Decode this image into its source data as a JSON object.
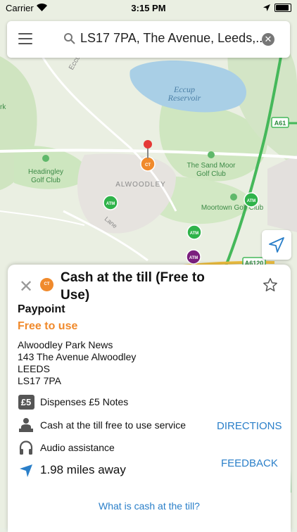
{
  "status_bar": {
    "carrier": "Carrier",
    "time": "3:15 PM"
  },
  "search": {
    "query": "LS17 7PA, The Avenue, Leeds,..."
  },
  "map": {
    "labels": {
      "lake": [
        "Eccup",
        "Reservoir"
      ],
      "road_north": "Eccup",
      "a61": "A61",
      "a6120": "A6120",
      "golf_headingley": [
        "Headingley",
        "Golf Club"
      ],
      "golf_sandmoor": [
        "The Sand Moor",
        "Golf Club"
      ],
      "alwoodley": "ALWOODLEY",
      "golf_moortown": "Moortown Golf Club",
      "lane": "Lane",
      "edge_left": "rk"
    },
    "markers": {
      "atm": "ATM",
      "ct": "CT"
    }
  },
  "card": {
    "badge": "CT",
    "title": "Cash at the till (Free to Use)",
    "type": "Paypoint",
    "fee": "Free to use",
    "address": [
      "Alwoodley Park News",
      "143 The Avenue Alwoodley",
      "LEEDS",
      "LS17 7PA"
    ],
    "features": {
      "notes": "Dispenses £5 Notes",
      "notes_icon_text": "£5",
      "service": "Cash at the till free to use service",
      "audio": "Audio assistance",
      "distance": "1.98 miles away"
    },
    "directions": "DIRECTIONS",
    "feedback": "FEEDBACK",
    "faq_link": "What is cash at the till?"
  },
  "colors": {
    "accent_orange": "#f08a2c",
    "link_blue": "#2a7fc9",
    "atm_green": "#2fb34a",
    "atm_purple": "#7b1f7e",
    "lake": "#a9cfe6"
  }
}
